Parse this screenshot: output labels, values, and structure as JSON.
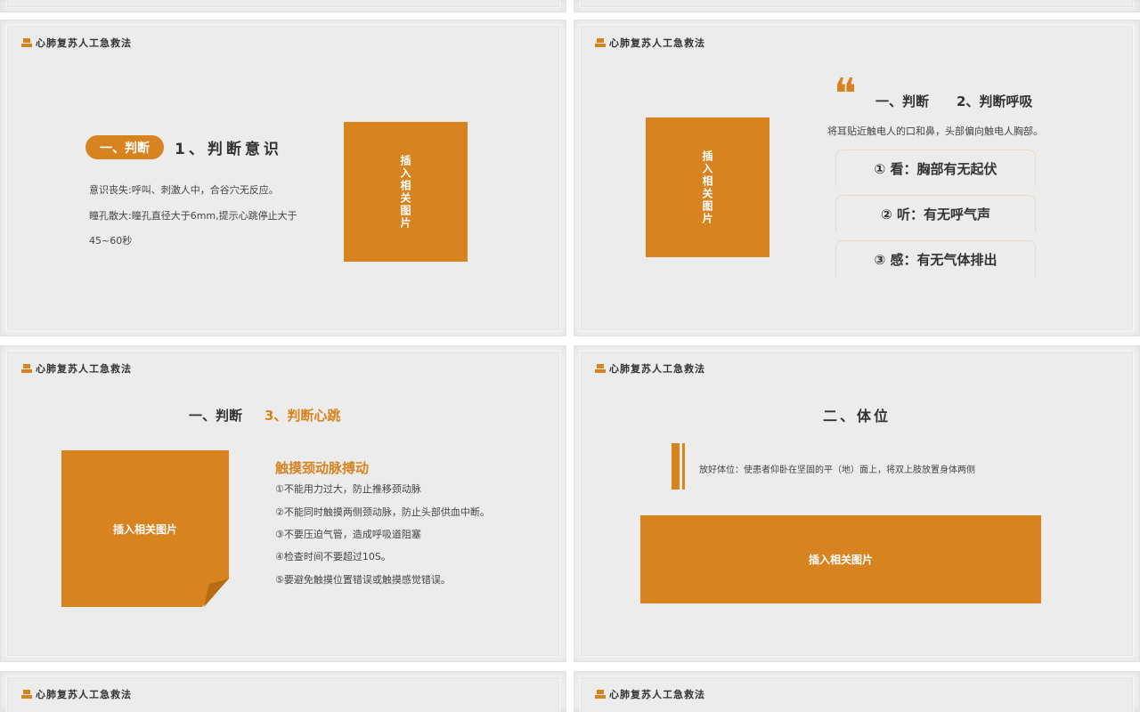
{
  "brand": "心肺复苏人工急救法",
  "slide1": {
    "pill": "一、判断",
    "heading": "1、判断意识",
    "line1": "意识丧失:呼叫、刺激人中，合谷穴无反应。",
    "line2": "瞳孔散大:瞳孔直径大于6mm,提示心跳停止大于",
    "line3": "45~60秒",
    "image_label": "插入相关图片"
  },
  "slide2": {
    "quote_glyph": "❝",
    "title_a": "一、判断",
    "title_b": "2、判断呼吸",
    "desc": "将耳贴近触电人的口和鼻，头部偏向触电人胸部。",
    "items": [
      "① 看：胸部有无起伏",
      "② 听：有无呼气声",
      "③ 感：有无气体排出"
    ],
    "image_label": "插入相关图片"
  },
  "slide3": {
    "title_a": "一、判断",
    "title_b": "3、判断心跳",
    "sub": "触摸颈动脉搏动",
    "items": [
      "①不能用力过大，防止推移颈动脉",
      "②不能同时触摸两侧颈动脉，防止头部供血中断。",
      "③不要压迫气管，造成呼吸道阻塞",
      "④检查时间不要超过10S。",
      "⑤要避免触摸位置错误或触摸感觉错误。"
    ],
    "image_label": "插入相关图片"
  },
  "slide4": {
    "title": "二、体位",
    "desc": "放好体位：使患者仰卧在坚固的平（地）面上，将双上肢放置身体两侧",
    "image_label": "插入相关图片"
  },
  "colors": {
    "accent": "#d7831f",
    "slide_bg": "#ececec"
  }
}
